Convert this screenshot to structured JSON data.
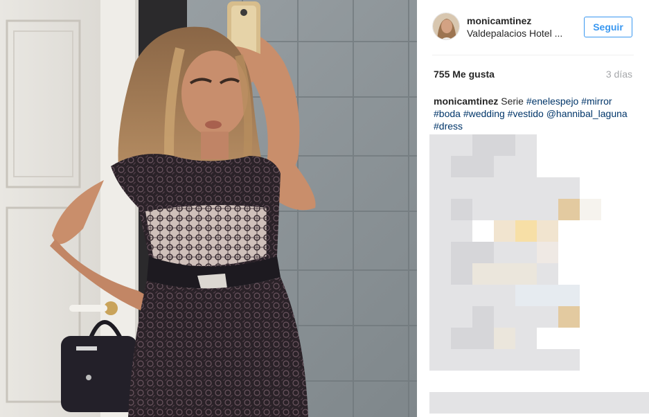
{
  "post": {
    "username": "monicamtinez",
    "location": "Valdepalacios Hotel ...",
    "follow_label": "Seguir",
    "likes": "755 Me gusta",
    "age": "3 días"
  },
  "caption": {
    "username": "monicamtinez",
    "text": "Serie",
    "tags": [
      "#enelespejo",
      "#mirror",
      "#boda",
      "#wedding",
      "#vestido",
      "@hannibal_laguna",
      "#dress"
    ]
  },
  "colors": {
    "link": "#003569",
    "accent": "#3897f0",
    "muted": "#a5a7aa"
  },
  "icons": {
    "avatar": "profile-photo"
  }
}
